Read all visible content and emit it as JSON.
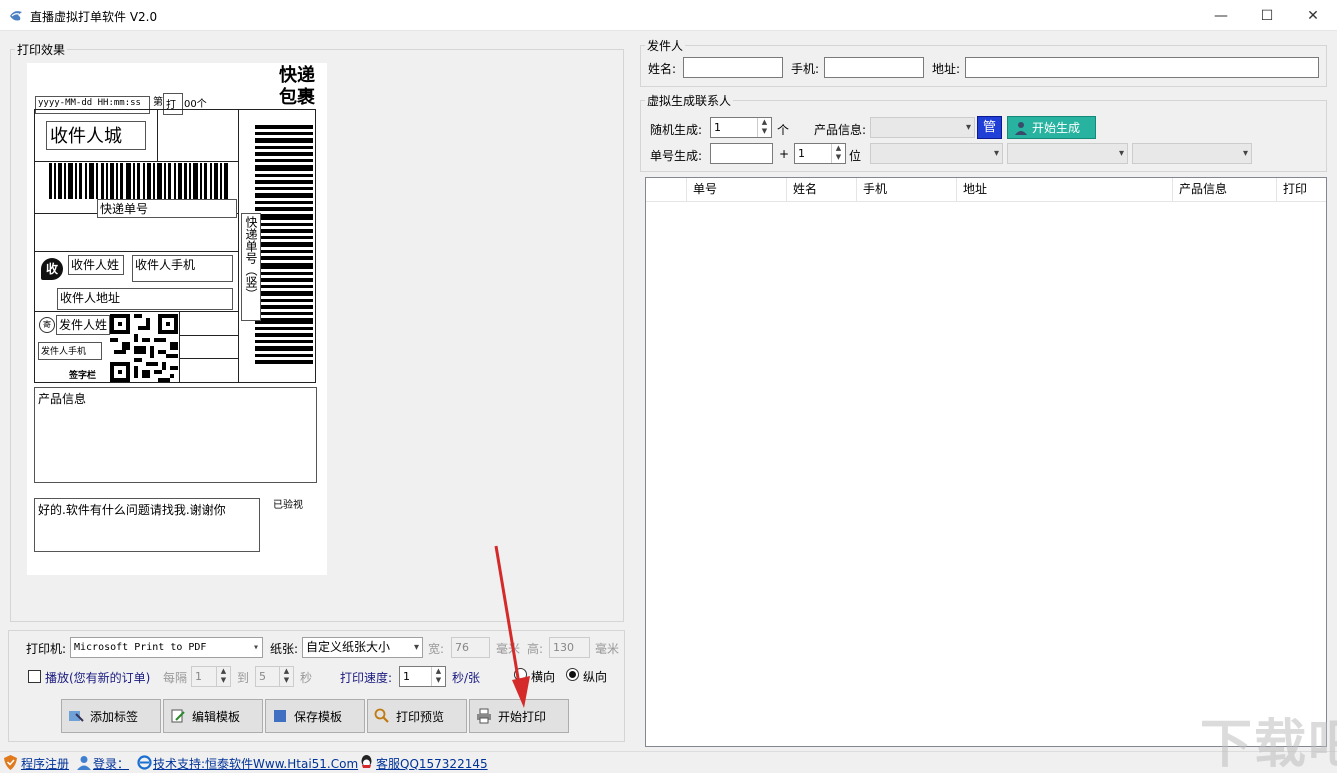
{
  "window": {
    "title": "直播虚拟打单软件 V2.0",
    "minimize": "—",
    "maximize": "☐",
    "close": "✕"
  },
  "preview_group": {
    "title": "打印效果"
  },
  "label": {
    "big_title_1": "快递",
    "big_title_2": "包裹",
    "datetime": "yyyy-MM-dd HH:mm:ss",
    "nth": "第",
    "print": "打",
    "count": "00个",
    "receiver_city": "收件人城",
    "tracking_no": "快递单号",
    "tracking_vertical": "快递单号（竖）",
    "receive_badge": "收",
    "receiver_name": "收件人姓",
    "receiver_phone": "收件人手机",
    "receiver_address": "收件人地址",
    "send_badge": "寄",
    "sender_name": "发件人姓",
    "sender_phone": "发件人手机",
    "signature": "签字栏",
    "product_info": "产品信息",
    "message": "好的.软件有什么问题请找我.谢谢你",
    "inspected": "已验视"
  },
  "print_settings": {
    "printer_label": "打印机:",
    "printer_value": "Microsoft Print to PDF",
    "paper_label": "纸张:",
    "paper_value": "自定义纸张大小",
    "width_label": "宽:",
    "width_value": "76",
    "mm1": "毫米",
    "height_label": "高:",
    "height_value": "130",
    "mm2": "毫米",
    "play_label": "播放(您有新的订单)",
    "interval_label": "每隔",
    "interval_from": "1",
    "to_label": "到",
    "interval_to": "5",
    "sec_label": "秒",
    "speed_label": "打印速度:",
    "speed_value": "1",
    "speed_unit": "秒/张",
    "landscape": "横向",
    "portrait": "纵向"
  },
  "buttons": {
    "add_label": "添加标签",
    "edit_template": "编辑模板",
    "save_template": "保存模板",
    "print_preview": "打印预览",
    "start_print": "开始打印"
  },
  "sender_group": {
    "title": "发件人",
    "name_label": "姓名:",
    "phone_label": "手机:",
    "address_label": "地址:"
  },
  "virtual_group": {
    "title": "虚拟生成联系人",
    "random_label": "随机生成:",
    "random_value": "1",
    "random_unit": "个",
    "product_label": "产品信息:",
    "manage": "管",
    "start_generate": "开始生成",
    "serial_label": "单号生成:",
    "plus": "+",
    "digits_value": "1",
    "digits_unit": "位"
  },
  "table": {
    "columns": [
      "单号",
      "姓名",
      "手机",
      "地址",
      "产品信息",
      "打印"
    ]
  },
  "statusbar": {
    "register": "程序注册",
    "login": "登录：",
    "support": "技术支持:恒泰软件Www.Htai51.Com",
    "service": "客服QQ157322145"
  },
  "watermark": "下载吧"
}
